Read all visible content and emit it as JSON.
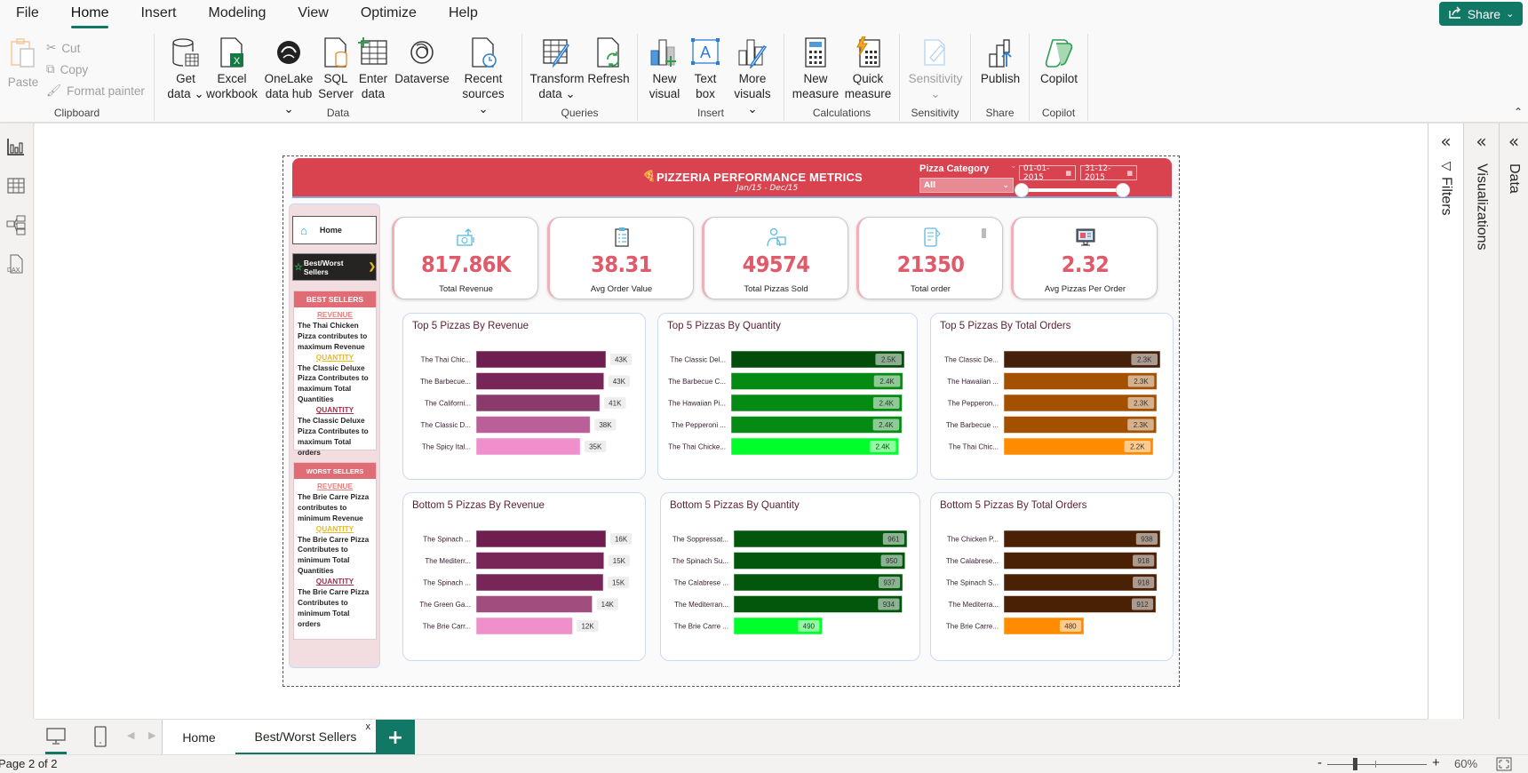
{
  "menu": {
    "items": [
      "File",
      "Home",
      "Insert",
      "Modeling",
      "View",
      "Optimize",
      "Help"
    ],
    "active": "Home",
    "share_label": "Share"
  },
  "ribbon": {
    "clipboard": {
      "label": "Clipboard",
      "paste": "Paste",
      "cut": "Cut",
      "copy": "Copy",
      "format_painter": "Format painter"
    },
    "data": {
      "label": "Data",
      "get_data": [
        "Get",
        "data"
      ],
      "excel": [
        "Excel",
        "workbook"
      ],
      "onelake": [
        "OneLake",
        "data hub"
      ],
      "sql": [
        "SQL",
        "Server"
      ],
      "enter": [
        "Enter",
        "data"
      ],
      "dataverse": "Dataverse",
      "recent": [
        "Recent",
        "sources"
      ]
    },
    "queries": {
      "label": "Queries",
      "transform": [
        "Transform",
        "data"
      ],
      "refresh": "Refresh"
    },
    "insert": {
      "label": "Insert",
      "new_visual": [
        "New",
        "visual"
      ],
      "text_box": [
        "Text",
        "box"
      ],
      "more_visuals": [
        "More",
        "visuals"
      ]
    },
    "calculations": {
      "label": "Calculations",
      "new_measure": [
        "New",
        "measure"
      ],
      "quick_measure": [
        "Quick",
        "measure"
      ]
    },
    "sensitivity": {
      "label": "Sensitivity",
      "button": "Sensitivity"
    },
    "share": {
      "label": "Share",
      "publish": "Publish"
    },
    "copilot": {
      "label": "Copilot",
      "button": "Copilot"
    }
  },
  "right_panes": {
    "filters": "Filters",
    "visualizations": "Visualizations",
    "data": "Data"
  },
  "report": {
    "title": "PIZZERIA PERFORMANCE METRICS",
    "subtitle": "Jan/15 - Dec/15",
    "slicer": {
      "label": "Pizza Category",
      "value": "All"
    },
    "date_start": "01-01-2015",
    "date_end": "31-12-2015",
    "nav": {
      "home": "Home",
      "best_worst": "Best/Worst Sellers"
    },
    "best_sellers": {
      "header": "BEST SELLERS",
      "sections": [
        {
          "heading": "REVENUE",
          "text": "The Thai Chicken Pizza contributes to maximum Revenue"
        },
        {
          "heading": "QUANTITY",
          "text": "The Classic Deluxe Pizza Contributes to maximum Total Quantities"
        },
        {
          "heading": "QUANTITY",
          "text": "The Classic Deluxe Pizza Contributes to maximum Total orders"
        }
      ]
    },
    "worst_sellers": {
      "header": "WORST SELLERS",
      "sections": [
        {
          "heading": "REVENUE",
          "text": "The Brie Carre Pizza contributes to minimum Revenue"
        },
        {
          "heading": "QUANTITY",
          "text": "The Brie Carre Pizza Contributes to minimum Total Quantities"
        },
        {
          "heading": "QUANTITY",
          "text": "The Brie  Carre Pizza Contributes to minimum Total orders"
        }
      ]
    },
    "kpis": [
      {
        "value": "817.86K",
        "label": "Total Revenue",
        "icon": "money-icon"
      },
      {
        "value": "38.31",
        "label": "Avg Order Value",
        "icon": "clipboard-icon"
      },
      {
        "value": "49574",
        "label": "Total Pizzas Sold",
        "icon": "delivery-person-icon"
      },
      {
        "value": "21350",
        "label": "Total order",
        "icon": "phone-order-icon"
      },
      {
        "value": "2.32",
        "label": "Avg Pizzas Per Order",
        "icon": "monitor-icon"
      }
    ]
  },
  "chart_data": [
    {
      "type": "bar",
      "orientation": "horizontal",
      "title": "Top 5 Pizzas By Revenue",
      "categories": [
        "The Thai Chic...",
        "The Barbecue...",
        "The Californi...",
        "The Classic D...",
        "The Spicy Ital..."
      ],
      "values": [
        43434,
        42768,
        41410,
        38180,
        34832
      ],
      "labels": [
        "43K",
        "43K",
        "41K",
        "38K",
        "35K"
      ],
      "colors": [
        "#6e1f4f",
        "#772657",
        "#8b3a6c",
        "#bb5f98",
        "#ef8fcb"
      ],
      "label_inside": false
    },
    {
      "type": "bar",
      "orientation": "horizontal",
      "title": "Top 5 Pizzas By Quantity",
      "categories": [
        "The Classic Del...",
        "The Barbecue C...",
        "The Hawaiian Pi...",
        "The Pepperoni ...",
        "The Thai Chicke..."
      ],
      "values": [
        2453,
        2432,
        2422,
        2418,
        2371
      ],
      "labels": [
        "2.5K",
        "2.4K",
        "2.4K",
        "2.4K",
        "2.4K"
      ],
      "colors": [
        "#024d0a",
        "#058a14",
        "#058a14",
        "#058a14",
        "#00ff2a"
      ],
      "label_inside": true
    },
    {
      "type": "bar",
      "orientation": "horizontal",
      "title": "Top 5 Pizzas By Total Orders",
      "categories": [
        "The Classic De...",
        "The Hawaiian ...",
        "The Pepperon...",
        "The Barbecue ...",
        "The Thai Chic..."
      ],
      "values": [
        2329,
        2280,
        2278,
        2273,
        2225
      ],
      "labels": [
        "2.3K",
        "2.3K",
        "2.3K",
        "2.3K",
        "2.2K"
      ],
      "colors": [
        "#45200a",
        "#a35100",
        "#a35100",
        "#a35100",
        "#ff8c00"
      ],
      "label_inside": true
    },
    {
      "type": "bar",
      "orientation": "horizontal",
      "title": "Bottom 5 Pizzas By Revenue",
      "categories": [
        "The Spinach ...",
        "The Mediterr...",
        "The Spinach ...",
        "The Green Ga...",
        "The Brie Carr..."
      ],
      "values": [
        15596,
        15360,
        15277,
        13956,
        11588
      ],
      "labels": [
        "16K",
        "15K",
        "15K",
        "14K",
        "12K"
      ],
      "colors": [
        "#6e1f4f",
        "#772657",
        "#772657",
        "#a14d7e",
        "#ef8fcb"
      ],
      "label_inside": false
    },
    {
      "type": "bar",
      "orientation": "horizontal",
      "title": "Bottom 5 Pizzas By Quantity",
      "categories": [
        "The Soppressat...",
        "The Spinach Su...",
        "The Calabrese ...",
        "The Mediterran...",
        "The Brie Carre ..."
      ],
      "values": [
        961,
        950,
        937,
        934,
        490
      ],
      "labels": [
        "961",
        "950",
        "937",
        "934",
        "490"
      ],
      "colors": [
        "#02570c",
        "#02570c",
        "#02570c",
        "#02570c",
        "#00ff2a"
      ],
      "label_inside": true
    },
    {
      "type": "bar",
      "orientation": "horizontal",
      "title": "Bottom 5 Pizzas By Total Orders",
      "categories": [
        "The Chicken P...",
        "The Calabrese...",
        "The Spinach S...",
        "The Mediterra...",
        "The Brie Carre..."
      ],
      "values": [
        938,
        918,
        918,
        912,
        480
      ],
      "labels": [
        "938",
        "918",
        "918",
        "912",
        "480"
      ],
      "colors": [
        "#4a2105",
        "#4a2105",
        "#4a2105",
        "#4a2105",
        "#ff8c00"
      ],
      "label_inside": true
    }
  ],
  "pages": {
    "tabs": [
      "Home",
      "Best/Worst Sellers"
    ],
    "active": "Best/Worst Sellers",
    "close": "x",
    "add": "+"
  },
  "status": {
    "page": "Page 2 of 2",
    "zoom": "60%",
    "zoom_fraction": 0.28,
    "minus": "-",
    "plus": "+"
  }
}
